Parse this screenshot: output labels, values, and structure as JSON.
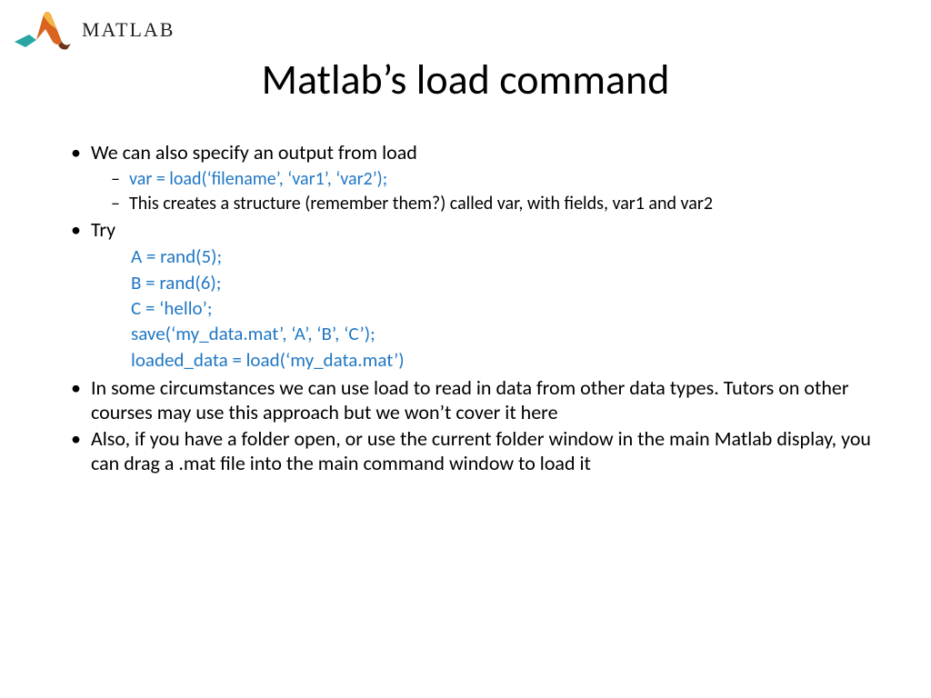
{
  "logo": {
    "brand_text": "MATLAB"
  },
  "title": "Matlab’s load command",
  "bullets": {
    "b1": "We can also specify an output from load",
    "b1_sub1": "var = load(‘filename’, ‘var1’, ‘var2’);",
    "b1_sub2": "This creates a structure (remember them?) called var, with fields, var1 and var2",
    "b2": "Try",
    "code": {
      "l1": "A = rand(5);",
      "l2": "B = rand(6);",
      "l3": "C = ‘hello’;",
      "l4": "save(‘my_data.mat’, ‘A’, ‘B’, ‘C’);",
      "l5": "loaded_data = load(‘my_data.mat’)"
    },
    "b3": "In some circumstances we can use load to read in data from other data types. Tutors on other courses may use this approach but we won’t cover it here",
    "b4": "Also, if you have a folder open, or use the current folder window in the main Matlab display, you can drag a .mat file into the main command window to load it"
  }
}
